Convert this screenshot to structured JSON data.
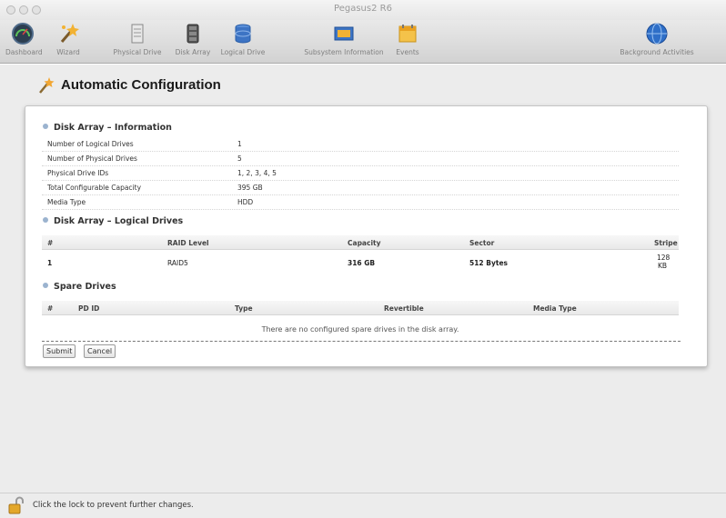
{
  "window": {
    "title": "Pegasus2 R6"
  },
  "toolbar": {
    "items": [
      {
        "label": "Dashboard",
        "icon": "dashboard-gauge-icon"
      },
      {
        "label": "Wizard",
        "icon": "wizard-wand-icon"
      },
      {
        "label": "Physical Drive",
        "icon": "physical-drive-icon"
      },
      {
        "label": "Disk Array",
        "icon": "disk-array-icon"
      },
      {
        "label": "Logical Drive",
        "icon": "logical-drive-icon"
      },
      {
        "label": "Subsystem Information",
        "icon": "subsystem-info-icon"
      },
      {
        "label": "Events",
        "icon": "events-calendar-icon"
      },
      {
        "label": "Background Activities",
        "icon": "background-activities-globe-icon"
      }
    ]
  },
  "page": {
    "title": "Automatic Configuration"
  },
  "info_section": {
    "heading": "Disk Array – Information",
    "rows": [
      {
        "label": "Number of Logical Drives",
        "value": "1"
      },
      {
        "label": "Number of Physical Drives",
        "value": "5"
      },
      {
        "label": "Physical Drive IDs",
        "value": "1, 2, 3, 4, 5"
      },
      {
        "label": "Total Configurable Capacity",
        "value": "395 GB"
      },
      {
        "label": "Media Type",
        "value": "HDD"
      }
    ]
  },
  "logical_section": {
    "heading": "Disk Array – Logical Drives",
    "columns": [
      "#",
      "RAID Level",
      "Capacity",
      "Sector",
      "Stripe"
    ],
    "rows": [
      {
        "num": "1",
        "raid": "RAID5",
        "capacity": "316 GB",
        "sector": "512 Bytes",
        "stripe_line1": "128",
        "stripe_line2": "KB"
      }
    ]
  },
  "spare_section": {
    "heading": "Spare Drives",
    "columns": [
      "#",
      "PD ID",
      "Type",
      "Revertible",
      "Media Type"
    ],
    "empty_message": "There are no configured spare drives in the disk array."
  },
  "buttons": {
    "submit": "Submit",
    "cancel": "Cancel"
  },
  "footer": {
    "lock_text": "Click the lock to prevent further changes."
  },
  "colors": {
    "accent": "#9bb3cf",
    "panel_bg": "#ffffff",
    "window_bg": "#ececec"
  }
}
